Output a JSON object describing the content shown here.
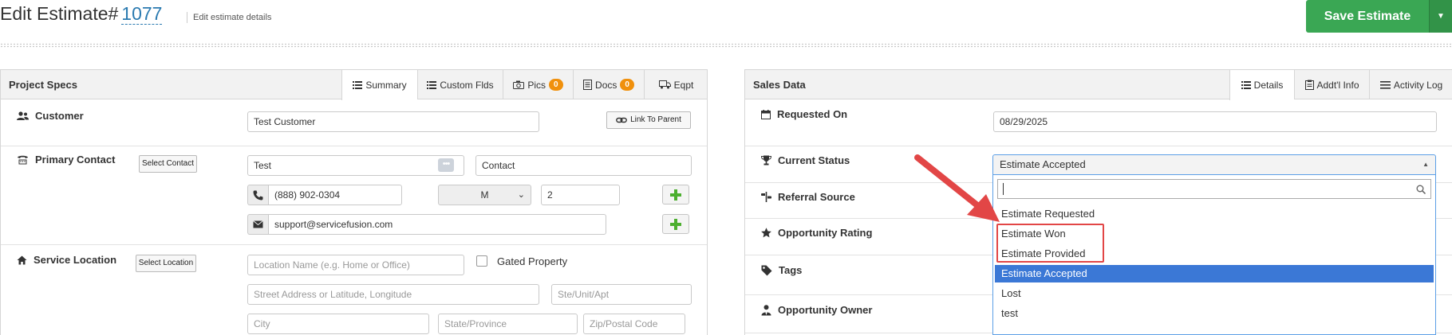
{
  "header": {
    "title_prefix": "Edit Estimate#",
    "estimate_number": "1077",
    "subtitle": "Edit estimate details",
    "save_label": "Save Estimate"
  },
  "project_specs": {
    "title": "Project Specs",
    "tabs": [
      {
        "label": "Summary",
        "icon": "list-icon",
        "active": true
      },
      {
        "label": "Custom Flds",
        "icon": "list-icon",
        "active": false
      },
      {
        "label": "Pics",
        "icon": "camera-icon",
        "badge": "0",
        "active": false
      },
      {
        "label": "Docs",
        "icon": "document-icon",
        "badge": "0",
        "active": false
      },
      {
        "label": "Eqpt",
        "icon": "truck-icon",
        "active": false
      }
    ],
    "customer": {
      "label": "Customer",
      "value": "Test Customer",
      "link_parent_label": "Link To Parent"
    },
    "primary_contact": {
      "label": "Primary Contact",
      "select_label": "Select Contact",
      "first_name": "Test",
      "last_name": "Contact",
      "phone": "(888) 902-0304",
      "phone_type": "M",
      "extension": "2",
      "email": "support@servicefusion.com"
    },
    "service_location": {
      "label": "Service Location",
      "select_label": "Select Location",
      "location_name_placeholder": "Location Name (e.g. Home or Office)",
      "gated_label": "Gated Property",
      "street_placeholder": "Street Address or Latitude, Longitude",
      "unit_placeholder": "Ste/Unit/Apt",
      "city_placeholder": "City",
      "state_placeholder": "State/Province",
      "zip_placeholder": "Zip/Postal Code"
    }
  },
  "sales_data": {
    "title": "Sales Data",
    "tabs": [
      {
        "label": "Details",
        "icon": "list-icon",
        "active": true
      },
      {
        "label": "Addt'l Info",
        "icon": "clipboard-icon",
        "active": false
      },
      {
        "label": "Activity Log",
        "icon": "lines-icon",
        "active": false
      }
    ],
    "requested_on": {
      "label": "Requested On",
      "value": "08/29/2025"
    },
    "current_status": {
      "label": "Current Status",
      "selected": "Estimate Accepted",
      "options": [
        "Estimate Requested",
        "Estimate Won",
        "Estimate Provided",
        "Estimate Accepted",
        "Lost",
        "test"
      ]
    },
    "referral_source": {
      "label": "Referral Source"
    },
    "opportunity_rating": {
      "label": "Opportunity Rating"
    },
    "tags": {
      "label": "Tags"
    },
    "opportunity_owner": {
      "label": "Opportunity Owner"
    }
  },
  "colors": {
    "save_green": "#3aa754",
    "accent_blue": "#2a7ab0",
    "selected_option": "#3b78d6",
    "badge_orange": "#f0900c",
    "annotation_red": "#e24646",
    "plus_green": "#4caf2f"
  }
}
